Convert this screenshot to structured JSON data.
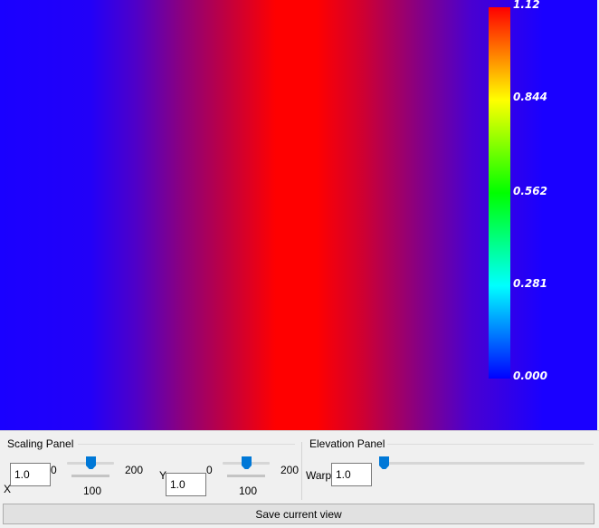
{
  "colorbar": {
    "ticks": [
      "1.12",
      "0.844",
      "0.562",
      "0.281",
      "0.000"
    ],
    "colormap": [
      "#0000ff",
      "#00ffff",
      "#00ff00",
      "#ffff00",
      "#ff0000"
    ]
  },
  "view": {
    "colors": {
      "edge": "#1a00ff",
      "center": "#ff0000"
    }
  },
  "scaling_panel": {
    "title": "Scaling Panel",
    "x": {
      "label": "X",
      "value": "1.0",
      "min": "0",
      "max": "200",
      "mid": "100",
      "slider_value": 100
    },
    "y": {
      "label": "Y",
      "value": "1.0",
      "min": "0",
      "max": "200",
      "mid": "100",
      "slider_value": 100
    }
  },
  "elevation_panel": {
    "title": "Elevation Panel",
    "warp_label": "Warp",
    "warp_value": "1.0",
    "slider_value": 0
  },
  "save_button": {
    "label": "Save current view"
  }
}
